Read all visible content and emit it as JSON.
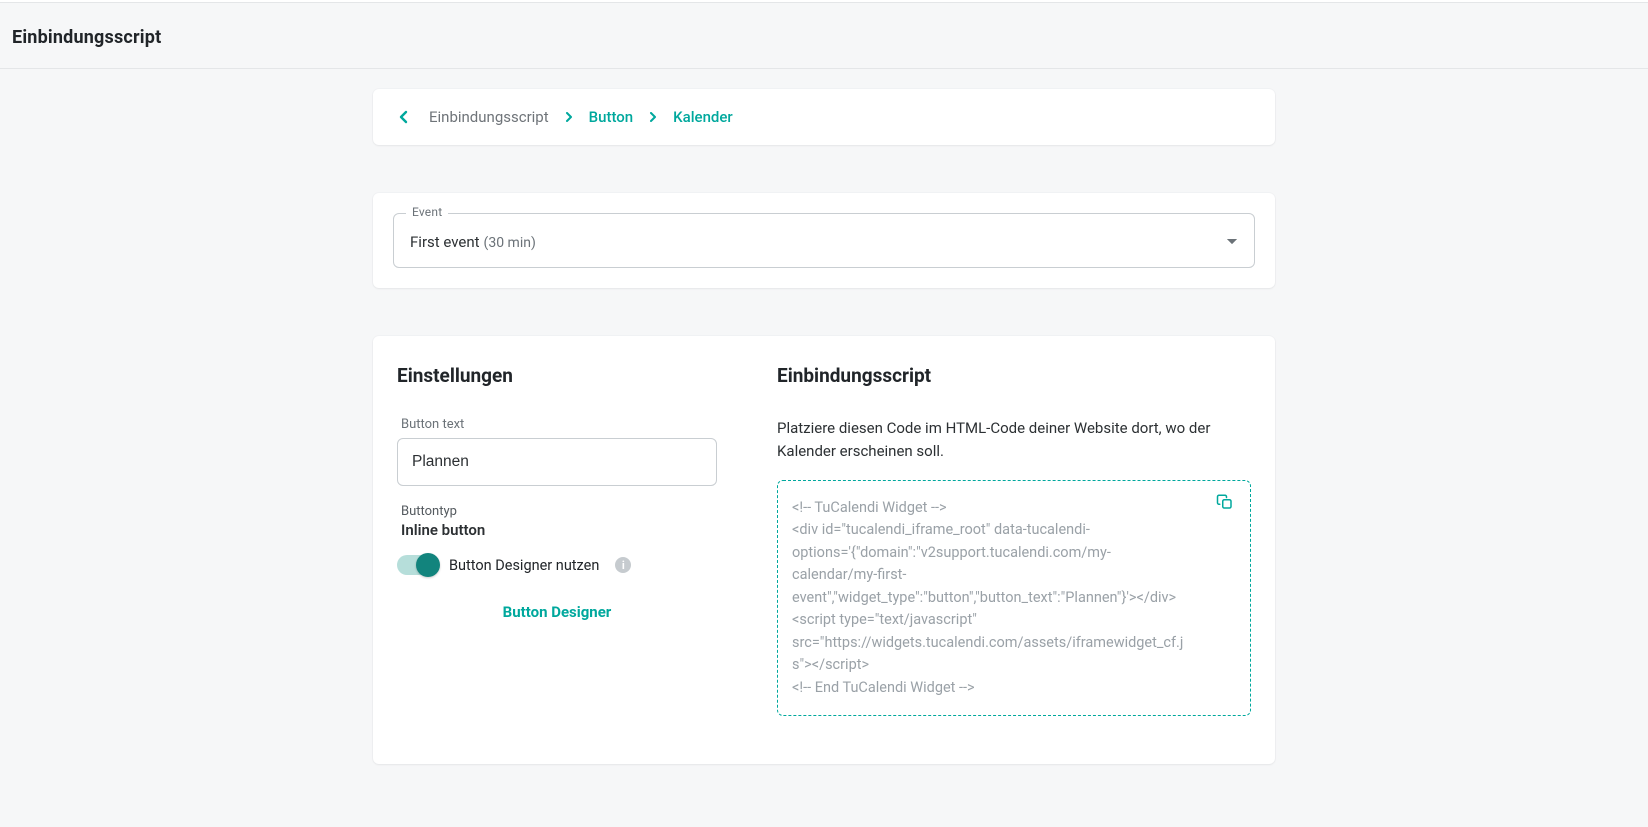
{
  "page": {
    "title": "Einbindungsscript"
  },
  "breadcrumb": {
    "items": [
      {
        "label": "Einbindungsscript",
        "link": false
      },
      {
        "label": "Button",
        "link": true
      },
      {
        "label": "Kalender",
        "link": true
      }
    ]
  },
  "eventSelect": {
    "legend": "Event",
    "value": "First event",
    "meta": "(30 min)"
  },
  "settings": {
    "title": "Einstellungen",
    "buttonTextLabel": "Button text",
    "buttonTextValue": "Plannen",
    "buttonTypeLabel": "Buttontyp",
    "buttonTypeValue": "Inline button",
    "useDesignerLabel": "Button Designer nutzen",
    "designerLink": "Button Designer"
  },
  "embed": {
    "title": "Einbindungsscript",
    "description": "Platziere diesen Code im HTML-Code deiner Website dort, wo der Kalender erscheinen soll.",
    "code": "<!-- TuCalendi Widget -->\n<div id=\"tucalendi_iframe_root\" data-tucalendi-options='{\"domain\":\"v2support.tucalendi.com/my-calendar/my-first-event\",\"widget_type\":\"button\",\"button_text\":\"Plannen\"}'></div>\n<script type=\"text/javascript\" src=\"https://widgets.tucalendi.com/assets/iframewidget_cf.js\"></script>\n<!-- End TuCalendi Widget -->"
  }
}
